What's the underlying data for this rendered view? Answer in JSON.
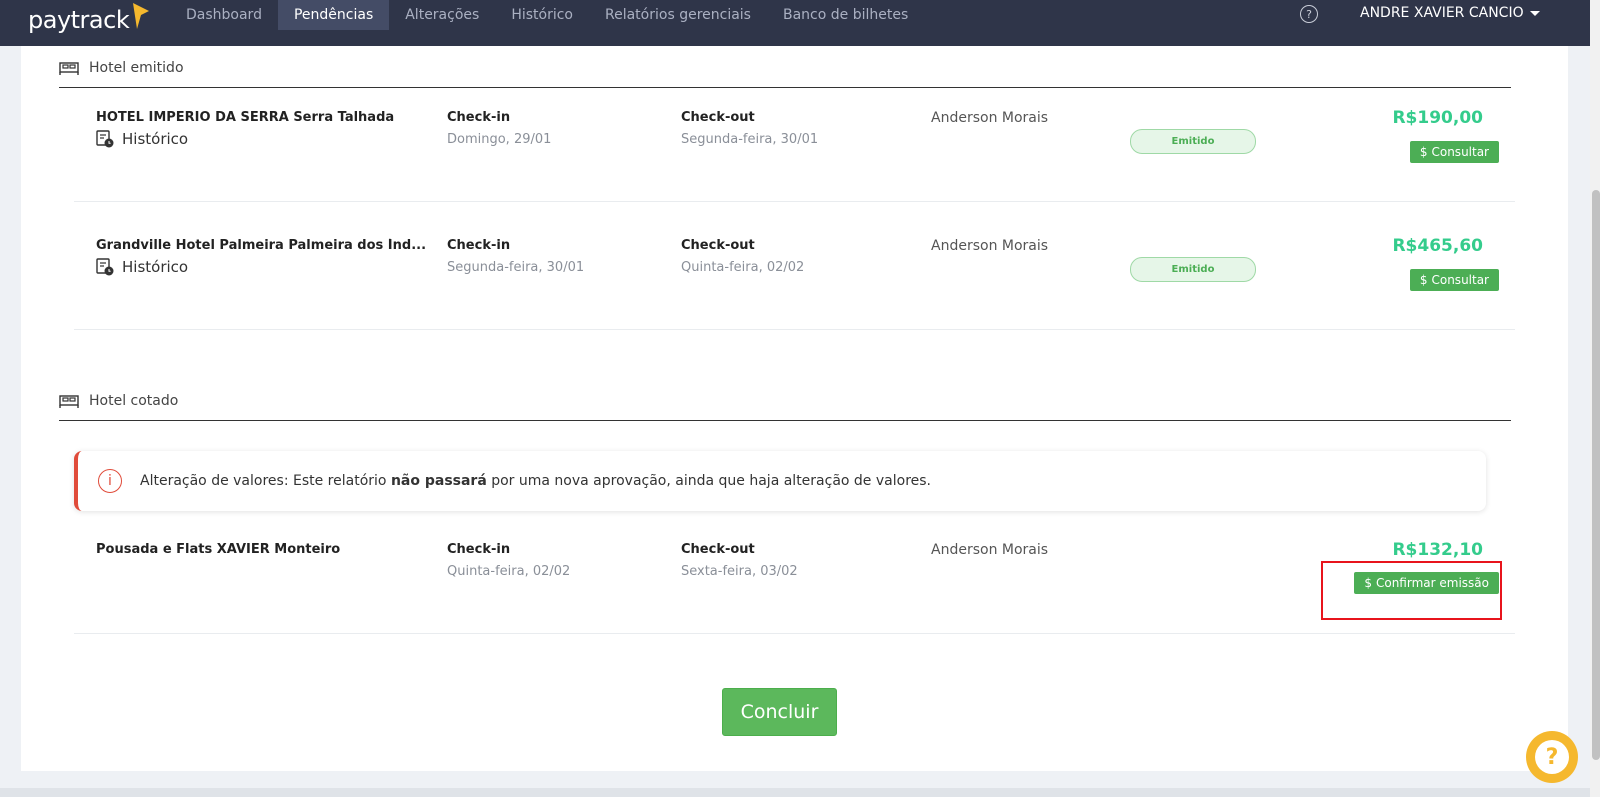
{
  "app": {
    "logo_text": "paytrack"
  },
  "nav": {
    "items": [
      {
        "label": "Dashboard",
        "active": false
      },
      {
        "label": "Pendências",
        "active": true
      },
      {
        "label": "Alterações",
        "active": false
      },
      {
        "label": "Histórico",
        "active": false
      },
      {
        "label": "Relatórios gerenciais",
        "active": false
      },
      {
        "label": "Banco de bilhetes",
        "active": false
      }
    ],
    "help_glyph": "?",
    "user_name": "ANDRE XAVIER CANCIO"
  },
  "sections": {
    "emitido": {
      "title": "Hotel emitido",
      "rows": [
        {
          "hotel": "HOTEL IMPERIO DA SERRA Serra Talhada",
          "history_label": "Histórico",
          "checkin_label": "Check-in",
          "checkin": "Domingo, 29/01",
          "checkout_label": "Check-out",
          "checkout": "Segunda-feira, 30/01",
          "traveler": "Anderson Morais",
          "status": "Emitido",
          "price": "R$190,00",
          "action": "Consultar"
        },
        {
          "hotel": "Grandville Hotel Palmeira Palmeira dos Índ...",
          "history_label": "Histórico",
          "checkin_label": "Check-in",
          "checkin": "Segunda-feira, 30/01",
          "checkout_label": "Check-out",
          "checkout": "Quinta-feira, 02/02",
          "traveler": "Anderson Morais",
          "status": "Emitido",
          "price": "R$465,60",
          "action": "Consultar"
        }
      ]
    },
    "cotado": {
      "title": "Hotel cotado",
      "alert": {
        "prefix": "Alteração de valores: Este relatório ",
        "bold": "não passará",
        "suffix": " por uma nova aprovação, ainda que haja alteração de valores."
      },
      "rows": [
        {
          "hotel": "Pousada e Flats XAVIER Monteiro",
          "checkin_label": "Check-in",
          "checkin": "Quinta-feira, 02/02",
          "checkout_label": "Check-out",
          "checkout": "Sexta-feira, 03/02",
          "traveler": "Anderson Morais",
          "price": "R$132,10",
          "action": "Confirmar emissão"
        }
      ]
    }
  },
  "footer": {
    "conclude_label": "Concluir"
  },
  "icons": {
    "dollar": "$",
    "alert_glyph": "i",
    "float_help_glyph": "?"
  },
  "colors": {
    "nav_bg": "#2f3549",
    "price_green": "#34cc8c",
    "button_green": "#4cae55",
    "alert_red": "#e04b3a",
    "highlight_red": "#e8141c"
  }
}
